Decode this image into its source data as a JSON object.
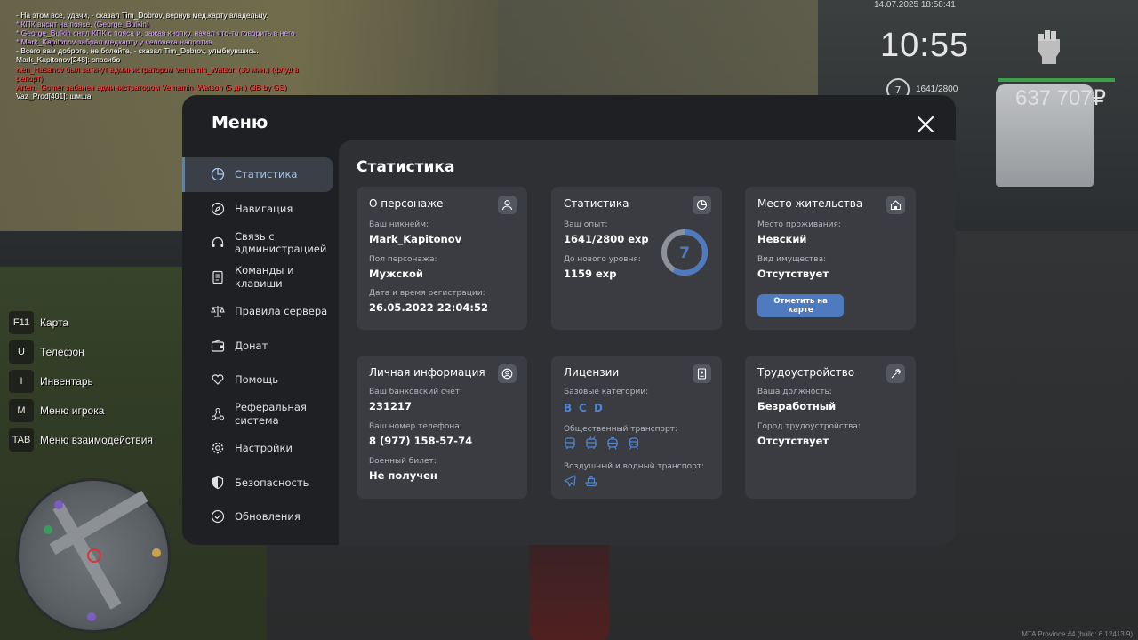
{
  "chat": [
    {
      "text": "- На этом все, удачи, - сказал Tim_Dobrov, вернув мед.карту владельцу.",
      "color": "#ffffff"
    },
    {
      "text": "* КПК висит на поясе. (George_Bulkin)",
      "color": "#d9a3ff"
    },
    {
      "text": "* George_Bulkin снял КПК с пояса и, зажав кнопку, начал что-то говорить в него",
      "color": "#d9a3ff"
    },
    {
      "text": "* Mark_Kapitonov забрал медкарту у человека напротив",
      "color": "#d9a3ff"
    },
    {
      "text": "- Всего вам доброго, не болейте, - сказал Tim_Dobrov, улыбнувшись.",
      "color": "#ffffff"
    },
    {
      "text": "Mark_Kapitonov[248]: спасибо",
      "color": "#ffffff"
    },
    {
      "text": "Ken_Hasanov был заткнут администратором Vemamin_Watson (30 мин.) (флуд в",
      "color": "#ff3b3b"
    },
    {
      "text": "репорт)",
      "color": "#ff3b3b"
    },
    {
      "text": "Artem_Gomer забанен администратором Vemamin_Watson (5 дн.) (ЗВ by GS)",
      "color": "#ff3b3b"
    },
    {
      "text": "Vaz_Prod[401]: шмша",
      "color": "#ffffff"
    }
  ],
  "hud": {
    "datetime": "14.07.2025 18:58:41",
    "clock": "10:55",
    "level": "7",
    "exp": "1641/2800",
    "money": "637 707₽"
  },
  "keybinds": [
    {
      "key": "F11",
      "label": "Карта"
    },
    {
      "key": "U",
      "label": "Телефон"
    },
    {
      "key": "I",
      "label": "Инвентарь"
    },
    {
      "key": "M",
      "label": "Меню игрока"
    },
    {
      "key": "TAB",
      "label": "Меню взаимодействия"
    }
  ],
  "watermark": "MTA Province #4 (build: 6.12413.9)",
  "menu": {
    "title": "Меню",
    "sidebar": [
      {
        "label": "Статистика",
        "icon": "pie-chart-icon",
        "active": true
      },
      {
        "label": "Навигация",
        "icon": "compass-icon"
      },
      {
        "label": "Связь с администрацией",
        "icon": "headset-icon"
      },
      {
        "label": "Команды и клавиши",
        "icon": "document-icon"
      },
      {
        "label": "Правила сервера",
        "icon": "scales-icon"
      },
      {
        "label": "Донат",
        "icon": "wallet-icon"
      },
      {
        "label": "Помощь",
        "icon": "heart-hands-icon"
      },
      {
        "label": "Реферальная система",
        "icon": "network-icon"
      },
      {
        "label": "Настройки",
        "icon": "gear-icon"
      },
      {
        "label": "Безопасность",
        "icon": "shield-icon"
      },
      {
        "label": "Обновления",
        "icon": "check-circle-icon"
      }
    ],
    "content_title": "Статистика",
    "cards": {
      "character": {
        "title": "О персонаже",
        "nickname_label": "Ваш никнейм:",
        "nickname": "Mark_Kapitonov",
        "gender_label": "Пол персонажа:",
        "gender": "Мужской",
        "reg_label": "Дата и время регистрации:",
        "reg": "26.05.2022 22:04:52"
      },
      "stats": {
        "title": "Статистика",
        "exp_label": "Ваш опыт:",
        "exp": "1641/2800 exp",
        "next_label": "До нового уровня:",
        "next": "1159 exp",
        "level": "7",
        "progress": 0.586
      },
      "residence": {
        "title": "Место жительства",
        "place_label": "Место проживания:",
        "place": "Невский",
        "property_label": "Вид имущества:",
        "property": "Отсутствует",
        "map_button": "Отметить на карте"
      },
      "personal": {
        "title": "Личная информация",
        "bank_label": "Ваш банковский счет:",
        "bank": "231217",
        "phone_label": "Ваш номер телефона:",
        "phone": "8 (977) 158-57-74",
        "military_label": "Военный билет:",
        "military": "Не получен"
      },
      "licenses": {
        "title": "Лицензии",
        "base_label": "Базовые категории:",
        "categories": [
          "B",
          "C",
          "D"
        ],
        "public_label": "Общественный транспорт:",
        "public_icons": [
          "bus-icon",
          "trolleybus-icon",
          "tram-icon",
          "metro-icon"
        ],
        "air_label": "Воздушный и водный транспорт:",
        "air_icons": [
          "plane-icon",
          "boat-icon"
        ]
      },
      "job": {
        "title": "Трудоустройство",
        "position_label": "Ваша должность:",
        "position": "Безработный",
        "city_label": "Город трудоустройства:",
        "city": "Отсутствует"
      }
    }
  }
}
